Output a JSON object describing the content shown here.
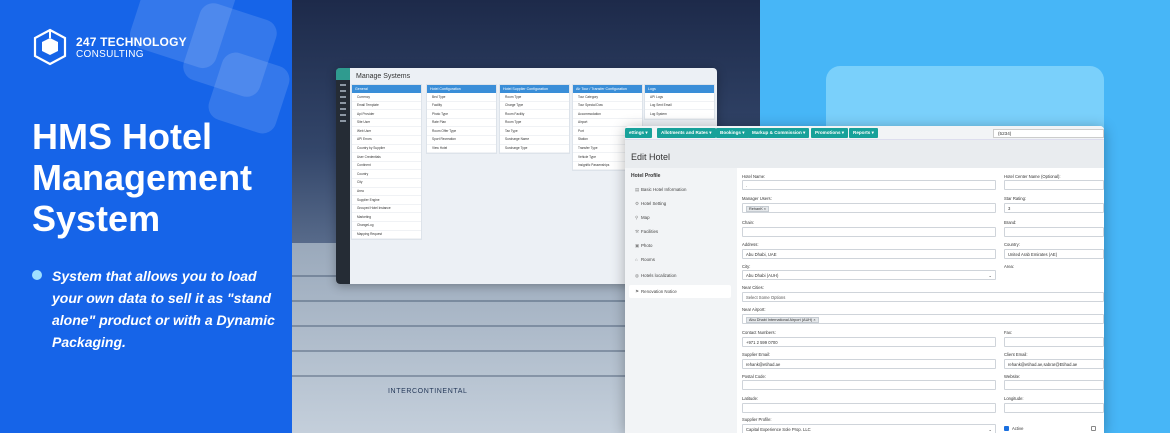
{
  "brand": {
    "line1": "247 TECHNOLOGY",
    "line2": "CONSULTING"
  },
  "headline": "HMS Hotel Management System",
  "bullet": "System that allows you to load your own data to sell it as \"stand alone\" product or with a Dynamic Packaging.",
  "photo_sign": "INTERCONTINENTAL",
  "manage_systems": {
    "title": "Manage Systems",
    "columns": [
      {
        "header": "General",
        "items": [
          "Currency",
          "Email Template",
          "Api Provider",
          "Site User",
          "Web User",
          "API Errors",
          "Country by Supplier",
          "User Credentials",
          "Continent",
          "Country",
          "City",
          "Area",
          "Supplier Engine",
          "Grouped Hotel Instance",
          "Marketing",
          "ChangeLog",
          "Mapping Request"
        ]
      },
      {
        "header": "Hotel Configuration",
        "items": [
          "Bed Type",
          "Facility",
          "Photo Type",
          "Rate Plan",
          "Room Offer Type",
          "Sport Recreation",
          "View Hotel"
        ]
      },
      {
        "header": "Hotel Supplier Configuration",
        "items": [
          "Room Type",
          "Charge Type",
          "Room Facility",
          "Room Type",
          "Tax Type",
          "Surcharge Name",
          "Surcharge Type"
        ]
      },
      {
        "header": "Air Tour / Transfer Configuration",
        "items": [
          "Tour Category",
          "Tour Special Dow",
          "Accommodation",
          "Airport",
          "Port",
          "Station",
          "Transfer Type",
          "Vehicle Type",
          "Insignific Passenships"
        ]
      },
      {
        "header": "Logs",
        "items": [
          "API Logs",
          "Log Sent Email",
          "Log System"
        ]
      }
    ]
  },
  "edit_hotel": {
    "menu": [
      "ettings ▾",
      "Allotments and Rates ▾",
      "Bookings ▾",
      "Markup & Commission ▾",
      "Promotions ▾",
      "Reports ▾"
    ],
    "hotel_select": "(5234)",
    "page_title": "Edit Hotel",
    "sidebar_title": "Hotel Profile",
    "sidebar_items": [
      "Basic Hotel Information",
      "Hotel Setting",
      "Map",
      "Facilities",
      "Photo",
      "Rooms",
      "Hotels localization",
      "Renovation Notice"
    ],
    "form": {
      "hotel_name_label": "Hotel Name:",
      "hotel_name_value": ".",
      "hotel_center_label": "Hotel Center Name (Optional):",
      "manager_label": "Manager Users:",
      "manager_tag": "RehanK ×",
      "star_label": "Star Rating:",
      "star_value": "3",
      "chain_label": "Chain:",
      "brand_label": "Brand:",
      "address_label": "Address:",
      "address_value": "Abu Dhabi, UAE",
      "country_label": "Country:",
      "country_value": "United Arab Emirates (AE)",
      "city_label": "City:",
      "city_value": "Abu Dhabi (AUH)",
      "area_label": "Area:",
      "near_cities_label": "Near Cities:",
      "near_cities_placeholder": "Select Some Options",
      "near_airport_label": "Near Airport:",
      "near_airport_tag": "Abu Dhabi International Airport (AUH) ×",
      "contact_label": "Contact Numbers:",
      "contact_value": "+971 2 599 0700",
      "fax_label": "Fax:",
      "supplier_email_label": "Supplier Email:",
      "supplier_email_value": "rehank@etihad.ae",
      "client_email_label": "Client Email:",
      "client_email_value": "rehank@etihad.ae,sabrar@Etihad.ae",
      "postal_label": "Postal Code:",
      "website_label": "Website:",
      "latitude_label": "Latitude:",
      "longitude_label": "Longitude:",
      "supplier_profile_label": "Supplier Profile:",
      "supplier_profile_value": "Capital Experience Sole Prop. LLC",
      "active_label": "Active"
    }
  },
  "colors": {
    "brand_blue": "#1664e8",
    "accent_teal": "#17a19a",
    "bg_blue": "#3aa0f2"
  }
}
